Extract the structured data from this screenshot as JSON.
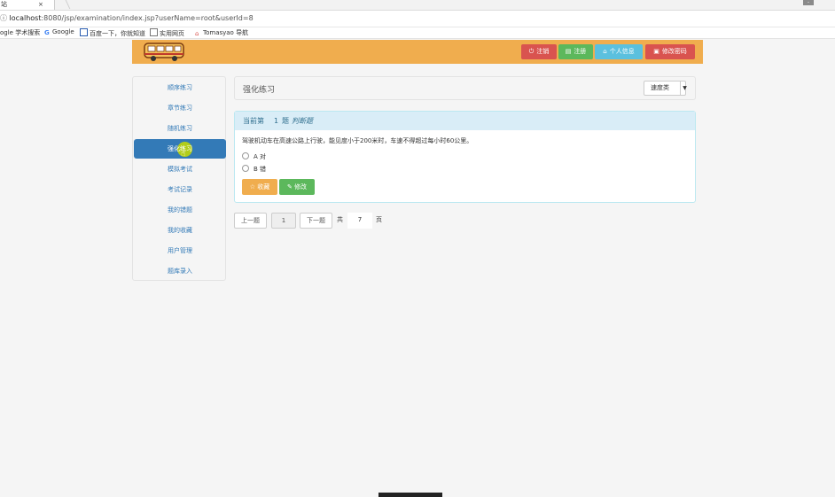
{
  "browser": {
    "tab_title": "站",
    "tab_close": "×",
    "url_host": "localhost",
    "url_rest": ":8080/jsp/examination/index.jsp?userName=root&userId=8",
    "bookmarks": [
      "ogle 学术搜索",
      "Google",
      "百度一下，你就知道",
      "实用网页",
      "Tomasyao 导航"
    ]
  },
  "header": {
    "buttons": [
      {
        "label": "注销",
        "icon": "power-icon",
        "color": "#d9534f"
      },
      {
        "label": "注册",
        "icon": "list-icon",
        "color": "#5cb85c"
      },
      {
        "label": "个人信息",
        "icon": "home-icon",
        "color": "#5bc0de"
      },
      {
        "label": "修改密码",
        "icon": "lock-icon",
        "color": "#d9534f"
      }
    ]
  },
  "sidebar": {
    "items": [
      {
        "label": "顺序练习"
      },
      {
        "label": "章节练习"
      },
      {
        "label": "随机练习"
      },
      {
        "label": "强化练习",
        "active": true
      },
      {
        "label": "模拟考试"
      },
      {
        "label": "考试记录"
      },
      {
        "label": "我的错题"
      },
      {
        "label": "我的收藏"
      },
      {
        "label": "用户管理"
      },
      {
        "label": "题库录入"
      }
    ]
  },
  "main": {
    "title": "强化练习",
    "select_value": "速度类",
    "question": {
      "header_prefix": "当前第",
      "number": "1",
      "header_suffix": "题",
      "type": "判断题",
      "text": "驾驶机动车在高速公路上行驶，能见度小于200米时，车速不得超过每小时60公里。",
      "options": [
        "A 对",
        "B 错"
      ]
    },
    "actions": [
      {
        "label": "收藏",
        "icon": "star-icon",
        "color": "#f0ad4e"
      },
      {
        "label": "修改",
        "icon": "pencil-icon",
        "color": "#5cb85c"
      }
    ],
    "pager": {
      "prev": "上一题",
      "current": "1",
      "next": "下一题",
      "total_prefix": "共",
      "total": "7",
      "total_suffix": "页"
    }
  }
}
